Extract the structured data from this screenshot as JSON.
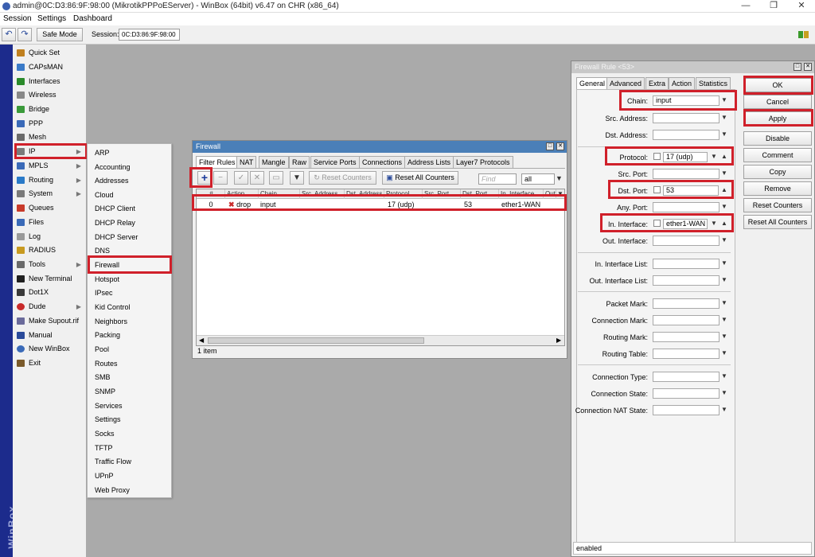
{
  "window": {
    "title": "admin@0C:D3:86:9F:98:00 (MikrotikPPPoEServer) - WinBox (64bit) v6.47 on CHR (x86_64)",
    "controls": {
      "minimize": "—",
      "maximize": "❐",
      "close": "✕"
    }
  },
  "menubar": [
    "Session",
    "Settings",
    "Dashboard"
  ],
  "toolbar": {
    "safe_mode": "Safe Mode",
    "session_label": "Session:",
    "session_value": "0C:D3:86:9F:98:00"
  },
  "sidebar": {
    "brand": "WinBox",
    "items": [
      {
        "label": "Quick Set",
        "icon": "wand-icon",
        "color": "#c08020"
      },
      {
        "label": "CAPsMAN",
        "icon": "antenna-icon",
        "color": "#3a7ac8"
      },
      {
        "label": "Interfaces",
        "icon": "interfaces-icon",
        "color": "#2a8a2a"
      },
      {
        "label": "Wireless",
        "icon": "wireless-icon",
        "color": "#888888"
      },
      {
        "label": "Bridge",
        "icon": "bridge-icon",
        "color": "#3a9a3a"
      },
      {
        "label": "PPP",
        "icon": "ppp-icon",
        "color": "#3a6ab8"
      },
      {
        "label": "Mesh",
        "icon": "mesh-icon",
        "color": "#6a6a6a"
      },
      {
        "label": "IP",
        "icon": "ip-icon",
        "color": "#7a7a7a",
        "submenu": true
      },
      {
        "label": "MPLS",
        "icon": "mpls-icon",
        "color": "#3a6ab8",
        "submenu": true
      },
      {
        "label": "Routing",
        "icon": "routing-icon",
        "color": "#2a7ac8",
        "submenu": true
      },
      {
        "label": "System",
        "icon": "gear-icon",
        "color": "#7a7a7a",
        "submenu": true
      },
      {
        "label": "Queues",
        "icon": "queues-icon",
        "color": "#c83a2a"
      },
      {
        "label": "Files",
        "icon": "files-icon",
        "color": "#3a6ab8"
      },
      {
        "label": "Log",
        "icon": "log-icon",
        "color": "#9a9a9a"
      },
      {
        "label": "RADIUS",
        "icon": "radius-icon",
        "color": "#c89a20"
      },
      {
        "label": "Tools",
        "icon": "tools-icon",
        "color": "#6a6a6a",
        "submenu": true
      },
      {
        "label": "New Terminal",
        "icon": "terminal-icon",
        "color": "#202020"
      },
      {
        "label": "Dot1X",
        "icon": "dot1x-icon",
        "color": "#3a3a3a"
      },
      {
        "label": "Dude",
        "icon": "dude-icon",
        "color": "#c82a2a",
        "submenu": true
      },
      {
        "label": "Make Supout.rif",
        "icon": "supout-icon",
        "color": "#6a6a9a"
      },
      {
        "label": "Manual",
        "icon": "manual-icon",
        "color": "#2a4a9a"
      },
      {
        "label": "New WinBox",
        "icon": "winbox-icon",
        "color": "#3a6ab8"
      },
      {
        "label": "Exit",
        "icon": "exit-icon",
        "color": "#7a5a2a"
      }
    ]
  },
  "ip_submenu": [
    "ARP",
    "Accounting",
    "Addresses",
    "Cloud",
    "DHCP Client",
    "DHCP Relay",
    "DHCP Server",
    "DNS",
    "Firewall",
    "Hotspot",
    "IPsec",
    "Kid Control",
    "Neighbors",
    "Packing",
    "Pool",
    "Routes",
    "SMB",
    "SNMP",
    "Services",
    "Settings",
    "Socks",
    "TFTP",
    "Traffic Flow",
    "UPnP",
    "Web Proxy"
  ],
  "firewall": {
    "title": "Firewall",
    "tabs": [
      "Filter Rules",
      "NAT",
      "Mangle",
      "Raw",
      "Service Ports",
      "Connections",
      "Address Lists",
      "Layer7 Protocols"
    ],
    "reset_counters": "Reset Counters",
    "reset_all_counters": "Reset All Counters",
    "find_placeholder": "Find",
    "filter_value": "all",
    "columns": [
      "#",
      "Action",
      "Chain",
      "Src. Address",
      "Dst. Address",
      "Protocol",
      "Src. Port",
      "Dst. Port",
      "In. Interface",
      "Out. Int..."
    ],
    "rows": [
      {
        "num": "0",
        "action": "drop",
        "chain": "input",
        "protocol": "17 (udp)",
        "dst_port": "53",
        "in_interface": "ether1-WAN"
      }
    ],
    "status": "1 item"
  },
  "rule": {
    "title": "Firewall Rule <53>",
    "tabs": [
      "General",
      "Advanced",
      "Extra",
      "Action",
      "Statistics"
    ],
    "chain_label": "Chain:",
    "chain_value": "input",
    "src_address_label": "Src. Address:",
    "dst_address_label": "Dst. Address:",
    "protocol_label": "Protocol:",
    "protocol_value": "17 (udp)",
    "src_port_label": "Src. Port:",
    "dst_port_label": "Dst. Port:",
    "dst_port_value": "53",
    "any_port_label": "Any. Port:",
    "in_interface_label": "In. Interface:",
    "in_interface_value": "ether1-WAN",
    "out_interface_label": "Out. Interface:",
    "in_interface_list_label": "In. Interface List:",
    "out_interface_list_label": "Out. Interface List:",
    "packet_mark_label": "Packet Mark:",
    "connection_mark_label": "Connection Mark:",
    "routing_mark_label": "Routing Mark:",
    "routing_table_label": "Routing Table:",
    "connection_type_label": "Connection Type:",
    "connection_state_label": "Connection State:",
    "connection_nat_state_label": "Connection NAT State:",
    "buttons": [
      "OK",
      "Cancel",
      "Apply",
      "Disable",
      "Comment",
      "Copy",
      "Remove",
      "Reset Counters",
      "Reset All Counters"
    ],
    "status": "enabled"
  },
  "highlight_color": "#d0202a"
}
